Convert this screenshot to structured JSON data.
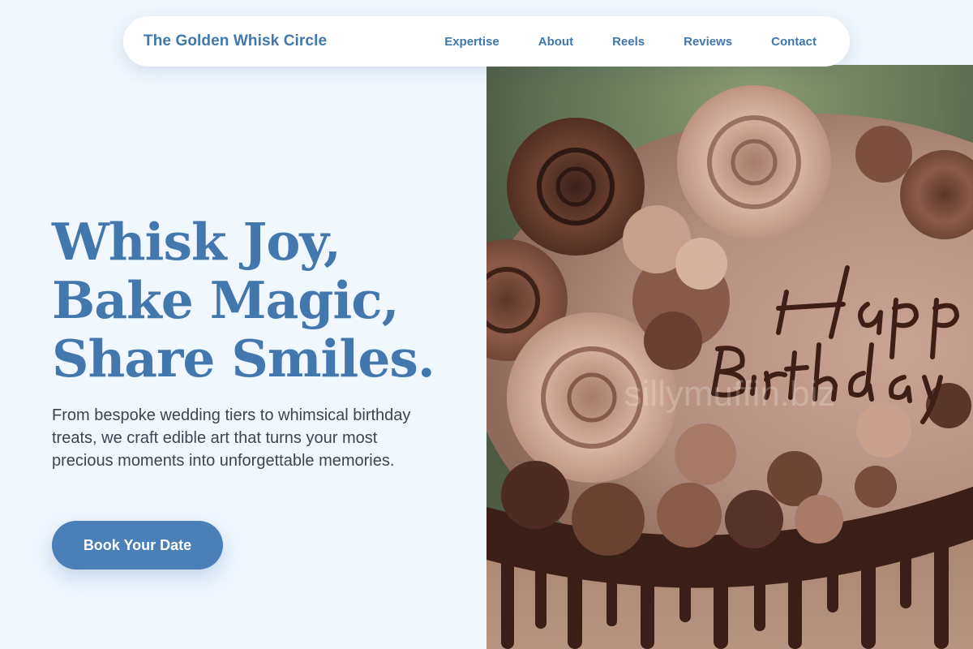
{
  "brand": {
    "name": "The Golden Whisk Circle"
  },
  "nav": {
    "links": [
      "Expertise",
      "About",
      "Reels",
      "Reviews",
      "Contact"
    ]
  },
  "hero": {
    "title_lines": [
      "Whisk Joy,",
      "Bake Magic,",
      "Share Smiles."
    ],
    "description": "From bespoke wedding tiers to whimsical birthday treats, we craft edible art that turns your most precious moments into unforgettable memories.",
    "cta_label": "Book Your Date"
  },
  "image": {
    "subject": "chocolate birthday cake with piped rosettes",
    "cake_writing_lines": [
      "Happy",
      "Birthday"
    ],
    "watermark": "sillymuffin.biz"
  },
  "colors": {
    "page_background": "#f0f7fe",
    "brand_blue": "#4278ad",
    "button_blue": "#4a80b7",
    "body_text": "#3c4552"
  }
}
